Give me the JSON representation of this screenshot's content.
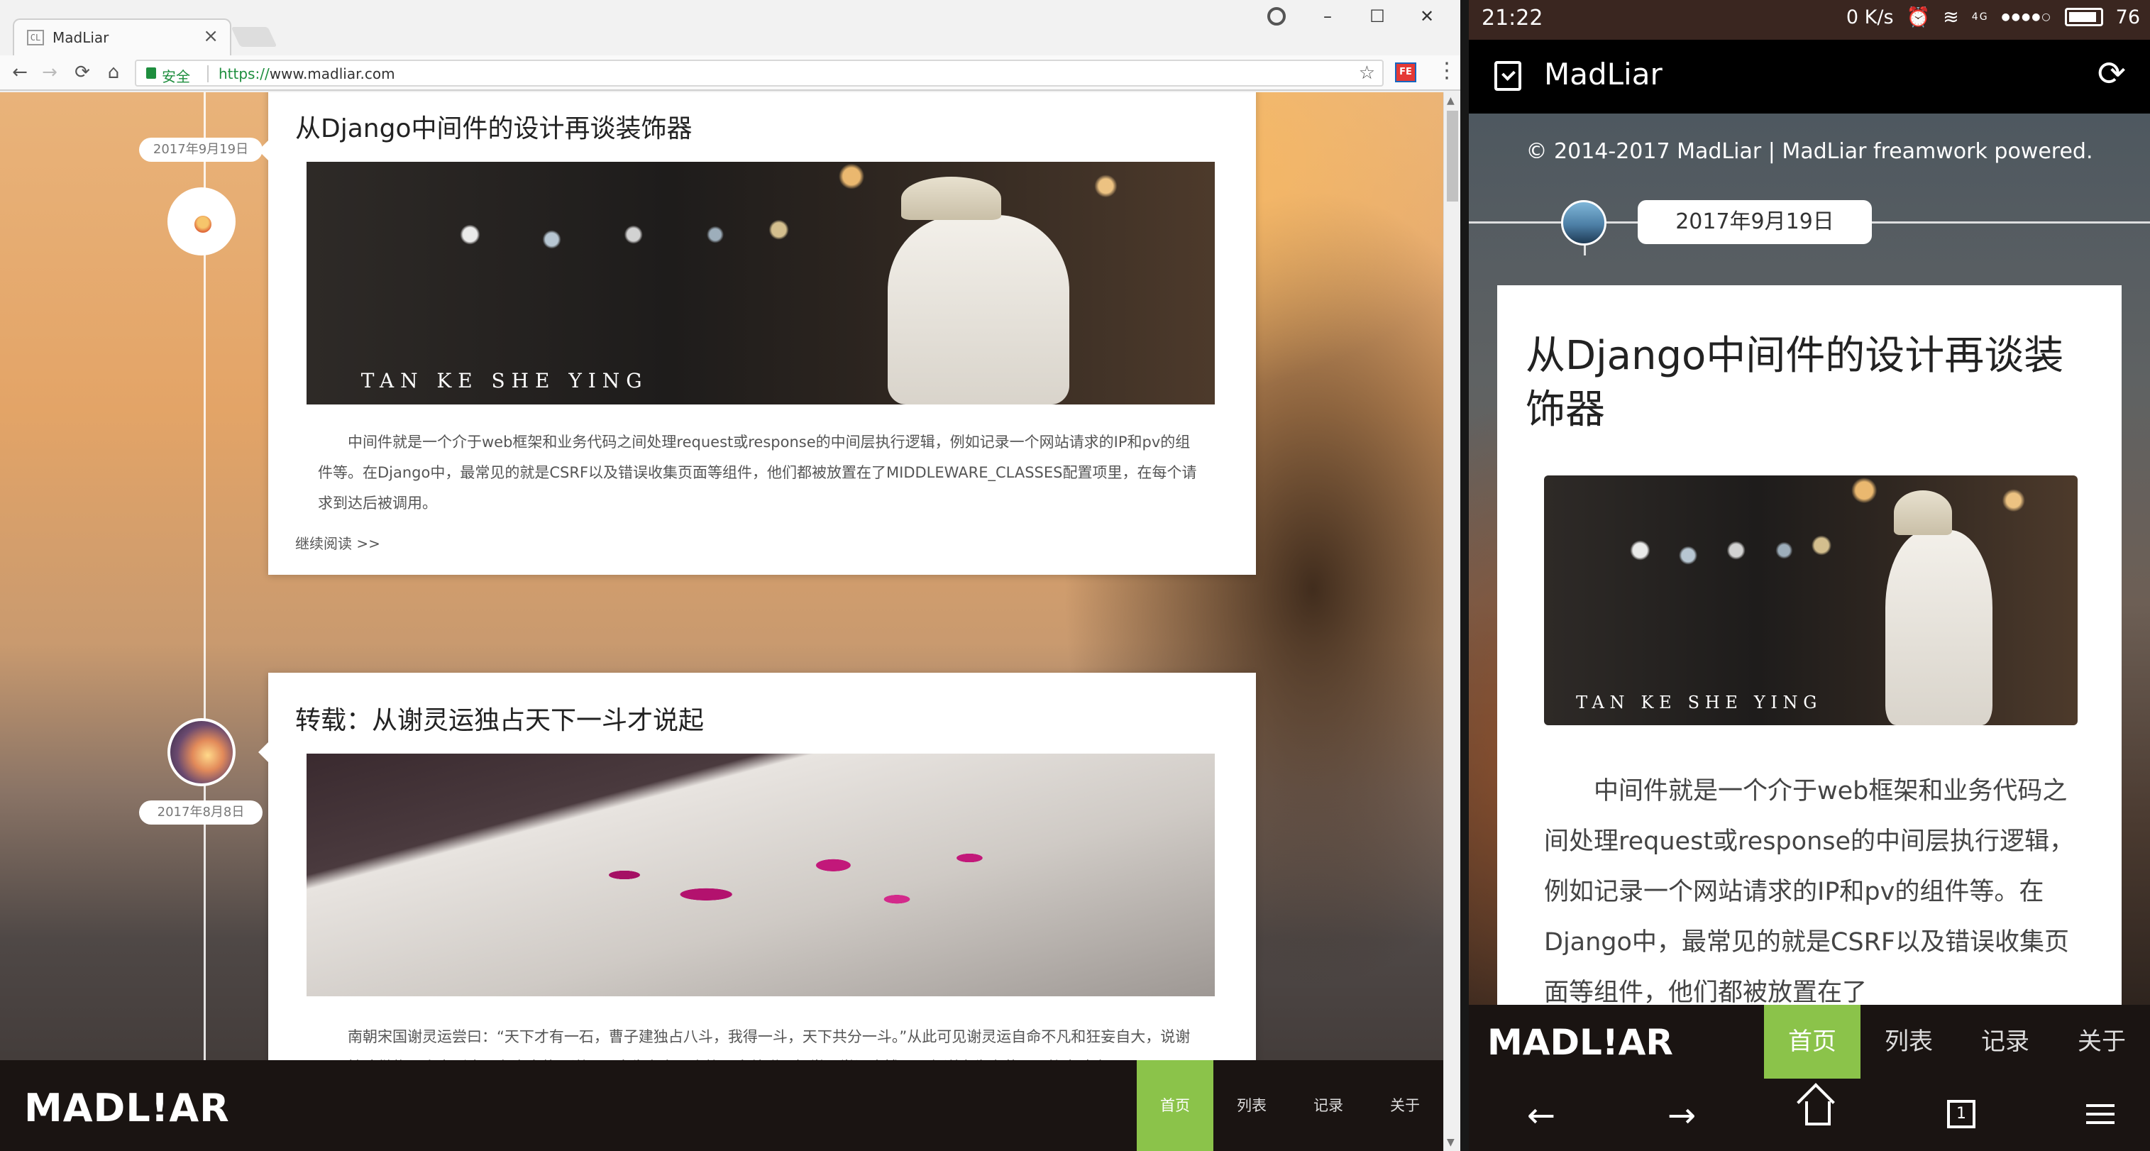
{
  "desktop": {
    "tab": {
      "favicon": "CL",
      "title": "MadLiar",
      "close": "×"
    },
    "window_buttons": {
      "minimize": "–",
      "maximize": "☐",
      "close": "✕"
    },
    "toolbar": {
      "back": "←",
      "forward": "→",
      "reload": "⟳",
      "home": "⌂",
      "secure_label": "安全",
      "url_scheme": "https://",
      "url_host": "www.madliar.com",
      "star": "☆",
      "extension": "FE",
      "menu": "⋮"
    },
    "page": {
      "copyright": "© 2014-2017 MadLiar | MadLiar freamwork powered.",
      "posts": [
        {
          "title": "从Django中间件的设计再谈装饰器",
          "date": "2017年9月19日",
          "image_text": "TAN KE SHE YING",
          "excerpt": "中间件就是一个介于web框架和业务代码之间处理request或response的中间层执行逻辑，例如记录一个网站请求的IP和pv的组件等。在Django中，最常见的就是CSRF以及错误收集页面等组件，他们都被放置在了MIDDLEWARE_CLASSES配置项里，在每个请求到达后被调用。",
          "read_more": "继续阅读 >>"
        },
        {
          "title": "转载：从谢灵运独占天下一斗才说起",
          "date": "2017年8月8日",
          "excerpt": "南朝宋国谢灵运尝曰：“天下才有一石，曹子建独占八斗，我得一斗，天下共分一斗。”从此可见谢灵运自命不凡和狂妄自大，说谢灵运持才傲物，人家刚也是有资本的。谢灵运出生在东晋上族，自幼聪明好学，学识广博，一句谢惠生春草，园柳变鸣禽。"
        }
      ],
      "footer": {
        "logo": "MADL!AR",
        "nav": [
          "首页",
          "列表",
          "记录",
          "关于"
        ],
        "active_index": 0,
        "active_color": "#8bc34a"
      }
    }
  },
  "mobile": {
    "status_bar": {
      "time": "21:22",
      "speed": "0 K/s",
      "network": "4G",
      "battery": "76"
    },
    "app_bar": {
      "title": "MadLiar",
      "refresh": "⟳"
    },
    "page": {
      "copyright": "© 2014-2017 MadLiar | MadLiar freamwork powered.",
      "date": "2017年9月19日",
      "post_title": "从Django中间件的设计再谈装饰器",
      "image_text": "TAN KE SHE YING",
      "excerpt": "中间件就是一个介于web框架和业务代码之间处理request或response的中间层执行逻辑，例如记录一个网站请求的IP和pv的组件等。在Django中，最常见的就是CSRF以及错误收集页面等组件，他们都被放置在了",
      "footer": {
        "logo": "MADL!AR",
        "nav": [
          "首页",
          "列表",
          "记录",
          "关于"
        ]
      }
    },
    "system_nav": {
      "back": "←",
      "forward": "→",
      "tabs": "1"
    }
  }
}
